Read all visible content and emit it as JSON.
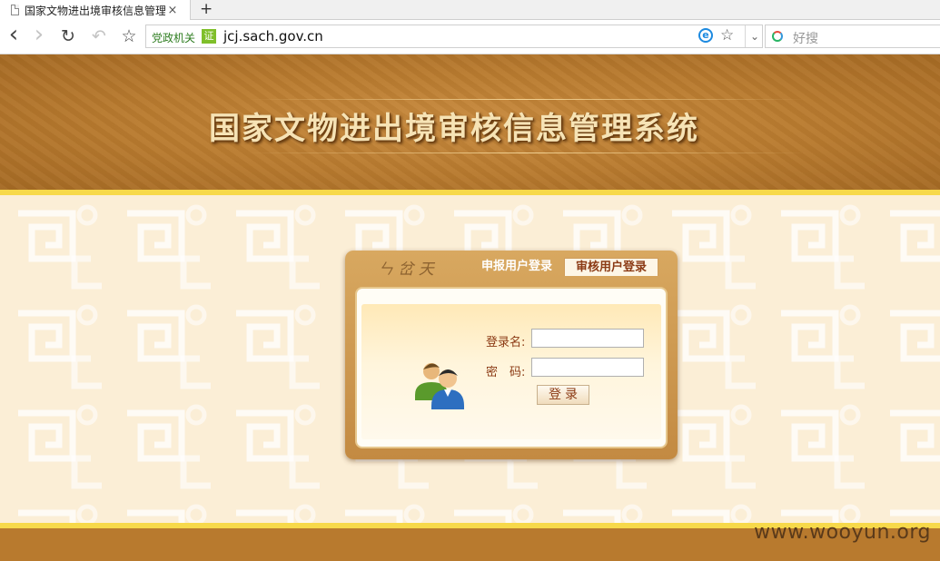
{
  "browser": {
    "tab_title": "国家文物进出境审核信息管理",
    "tab_close": "×",
    "new_tab": "+",
    "back": "‹",
    "forward": "›",
    "reload": "↻",
    "undo": "↶",
    "bookmark": "☆",
    "gov_label": "党政机关",
    "cert_label": "证",
    "url": "jcj.sach.gov.cn",
    "ie_label": "e",
    "fav_star": "☆",
    "dropdown": "⌄",
    "search_placeholder": "好搜"
  },
  "page": {
    "title": "国家文物进出境审核信息管理系统",
    "watermark": "www.wooyun.org"
  },
  "login": {
    "deco_text": "ㄣ 岔 天",
    "tab_declare": "申报用户登录",
    "tab_review": "审核用户登录",
    "username_label": "登录名:",
    "password_label": "密　码:",
    "username_value": "",
    "password_value": "",
    "submit_label": "登录"
  },
  "colors": {
    "banner": "#b87a2e",
    "band": "#f7d94a",
    "pattern_bg": "#fbeed6",
    "label": "#8b3a14"
  },
  "icons": [
    "page-icon",
    "close-icon",
    "back-icon",
    "forward-icon",
    "reload-icon",
    "undo-icon",
    "star-icon",
    "ie-icon",
    "chevron-down-icon",
    "search-icon",
    "users-icon"
  ]
}
